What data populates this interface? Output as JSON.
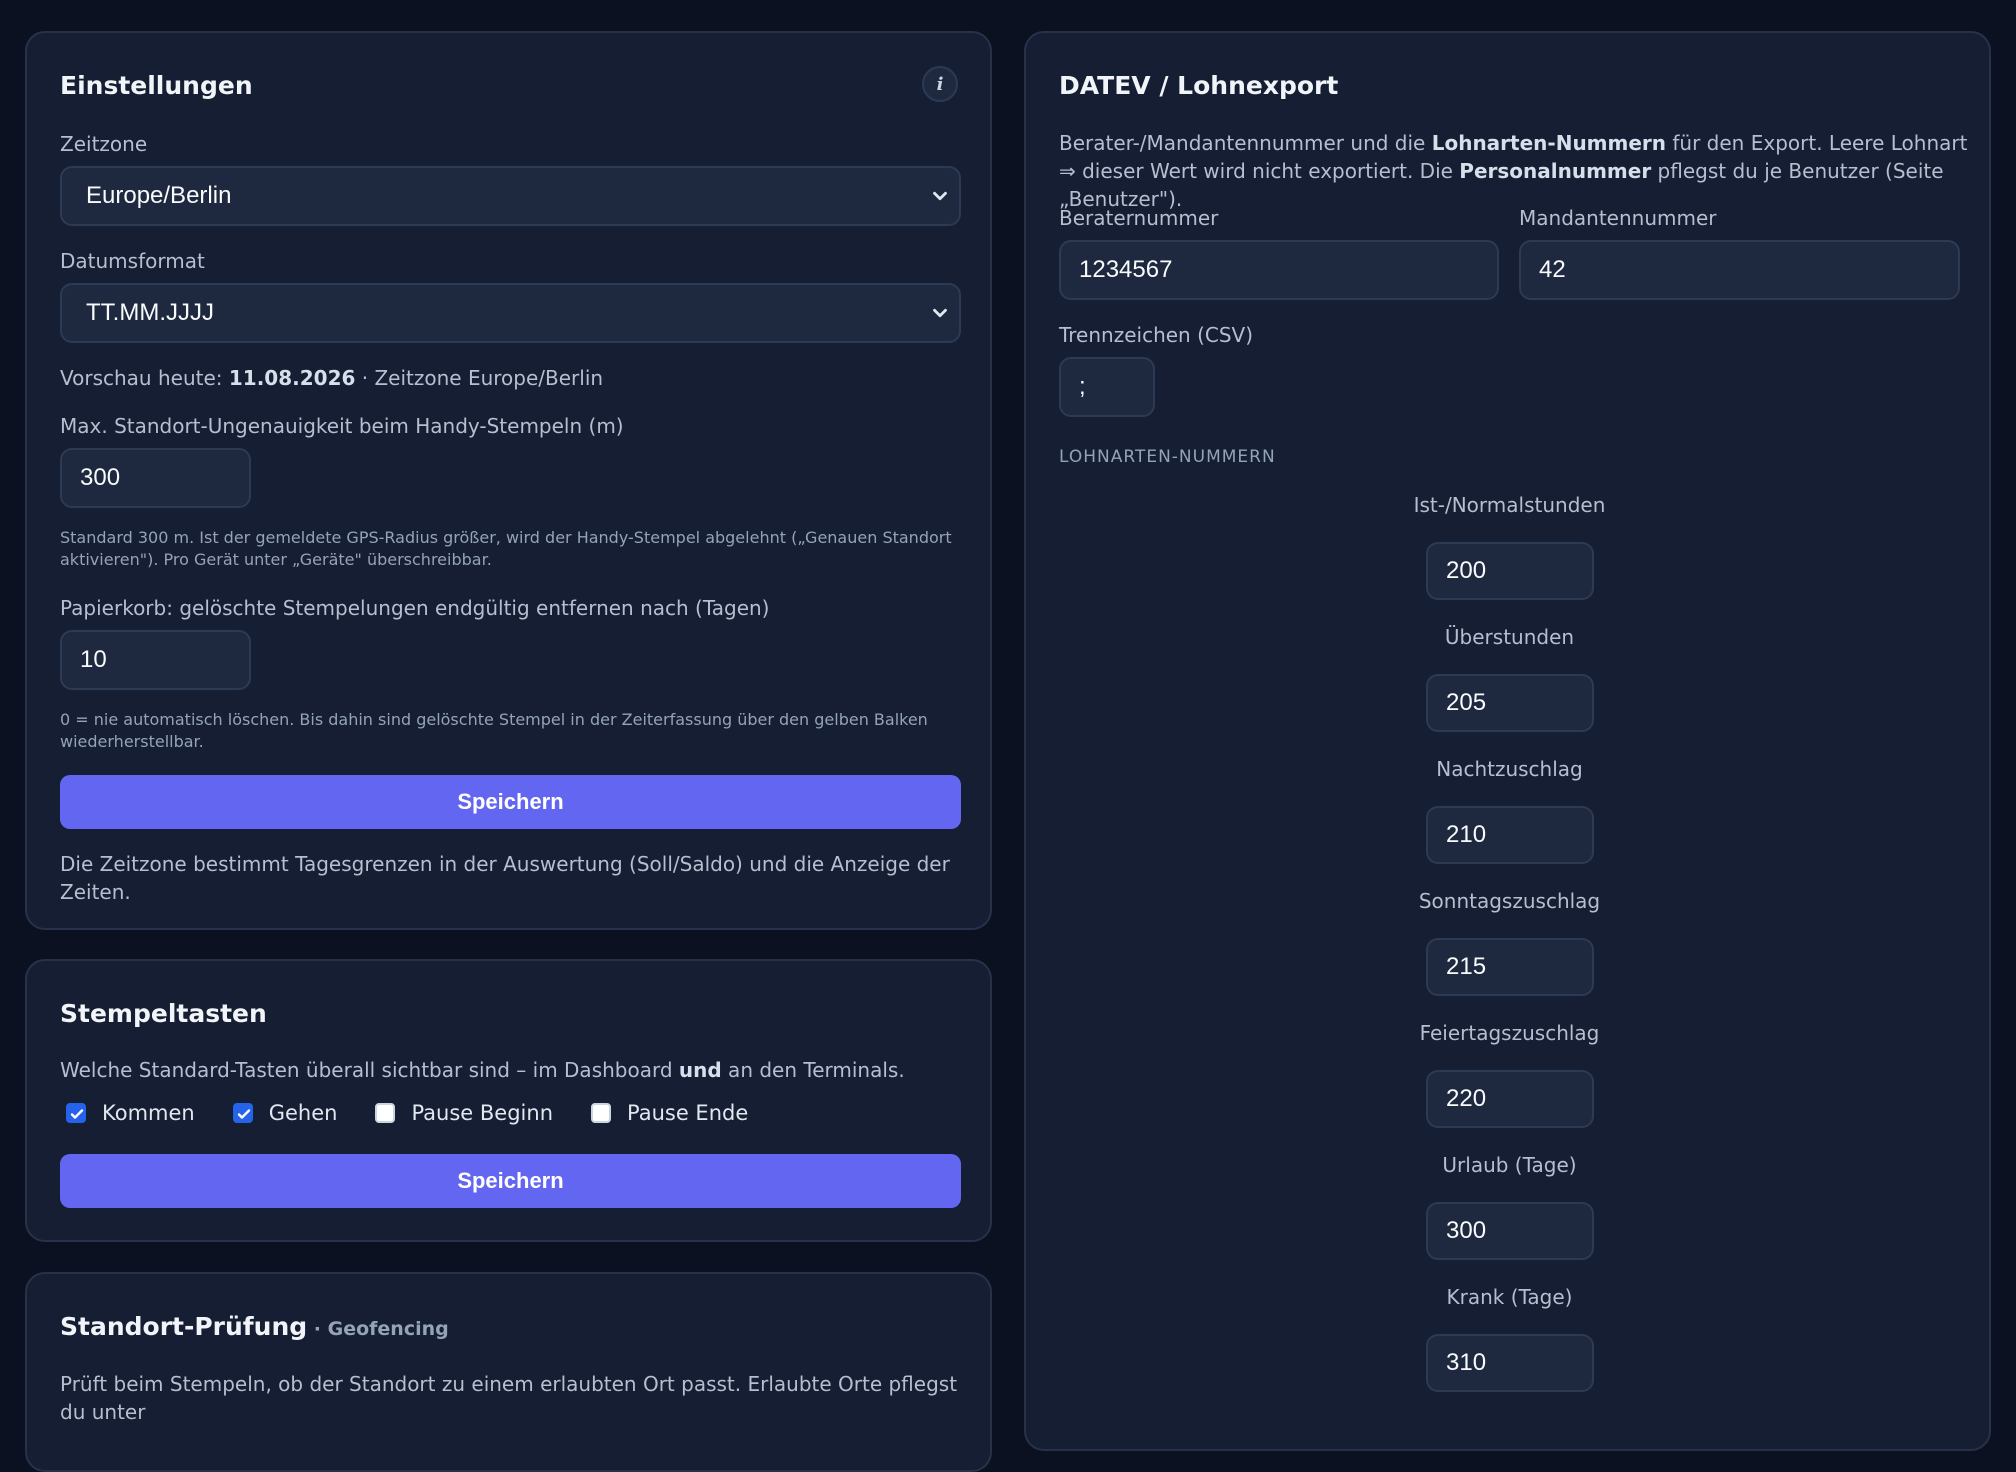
{
  "settings": {
    "title": "Einstellungen",
    "info_label": "i",
    "timezone_label": "Zeitzone",
    "timezone_value": "Europe/Berlin",
    "dateformat_label": "Datumsformat",
    "dateformat_value": "TT.MM.JJJJ",
    "preview_prefix": "Vorschau heute: ",
    "preview_date": "11.08.2026",
    "preview_suffix": " · Zeitzone Europe/Berlin",
    "accuracy_label": "Max. Standort-Ungenauigkeit beim Handy-Stempeln (m)",
    "accuracy_value": "300",
    "accuracy_hint": "Standard 300 m. Ist der gemeldete GPS-Radius größer, wird der Handy-Stempel abgelehnt („Genauen Standort aktivieren\"). Pro Gerät unter „Geräte\" überschreibbar.",
    "trash_label": "Papierkorb: gelöschte Stempelungen endgültig entfernen nach (Tagen)",
    "trash_value": "10",
    "trash_hint": "0 = nie automatisch löschen. Bis dahin sind gelöschte Stempel in der Zeiterfassung über den gelben Balken wiederherstellbar.",
    "save_label": "Speichern",
    "footer_text": "Die Zeitzone bestimmt Tagesgrenzen in der Auswertung (Soll/Saldo) und die Anzeige der Zeiten."
  },
  "stamp_buttons": {
    "title": "Stempeltasten",
    "desc_prefix": "Welche Standard-Tasten überall sichtbar sind – im Dashboard ",
    "desc_bold": "und",
    "desc_suffix": " an den Terminals.",
    "options": [
      {
        "label": "Kommen",
        "checked": true
      },
      {
        "label": "Gehen",
        "checked": true
      },
      {
        "label": "Pause Beginn",
        "checked": false
      },
      {
        "label": "Pause Ende",
        "checked": false
      }
    ],
    "save_label": "Speichern"
  },
  "geofence": {
    "title": "Standort-Prüfung",
    "subtitle": " · Geofencing",
    "desc": "Prüft beim Stempeln, ob der Standort zu einem erlaubten Ort passt. Erlaubte Orte pflegst du unter"
  },
  "datev": {
    "title": "DATEV / Lohnexport",
    "intro_1": "Berater-/Mandantennummer und die ",
    "intro_b1": "Lohnarten-Nummern",
    "intro_2": " für den Export. Leere Lohnart ⇒ dieser Wert wird nicht exportiert. Die ",
    "intro_b2": "Personalnummer",
    "intro_3": " pflegst du je Benutzer (Seite „Benutzer\").",
    "consultant_label": "Beraternummer",
    "consultant_value": "1234567",
    "client_label": "Mandantennummer",
    "client_value": "42",
    "separator_label": "Trennzeichen (CSV)",
    "separator_value": ";",
    "wage_types_caption": "LOHNARTEN-NUMMERN",
    "wage_types": [
      {
        "label": "Ist-/Normalstunden",
        "value": "200"
      },
      {
        "label": "Überstunden",
        "value": "205"
      },
      {
        "label": "Nachtzuschlag",
        "value": "210"
      },
      {
        "label": "Sonntagszuschlag",
        "value": "215"
      },
      {
        "label": "Feiertagszuschlag",
        "value": "220"
      },
      {
        "label": "Urlaub (Tage)",
        "value": "300"
      },
      {
        "label": "Krank (Tage)",
        "value": "310"
      }
    ]
  }
}
